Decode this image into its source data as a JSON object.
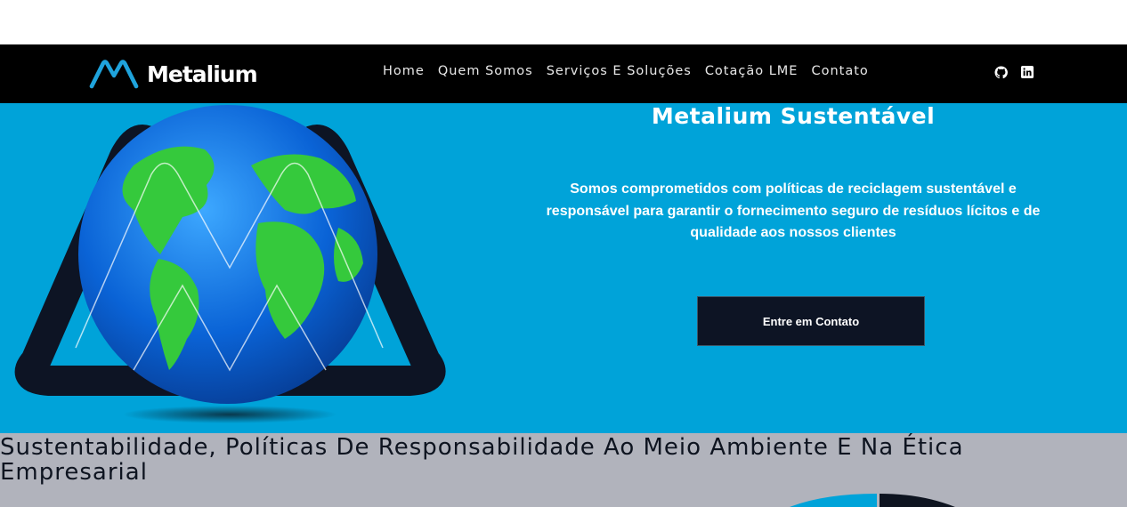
{
  "header": {
    "logo_text": "Metalium",
    "nav": [
      "Home",
      "Quem Somos",
      "Serviços E Soluções",
      "Cotação LME",
      "Contato"
    ],
    "social_icons": [
      "github-icon",
      "linkedin-icon"
    ]
  },
  "hero": {
    "title": "Metalium Sustentável",
    "text": "Somos comprometidos com políticas de reciclagem sustentável e responsável para garantir o fornecimento seguro de resíduos lícitos e de qualidade aos nossos clientes",
    "cta_label": "Entre em Contato"
  },
  "section2": {
    "title": "Sustentabilidade, Políticas De Responsabilidade Ao Meio Ambiente E Na Ética Empresarial"
  },
  "colors": {
    "navbar": "#000000",
    "hero_bg": "#00a3d9",
    "cta_bg": "#0d1424",
    "section2_bg": "#b1b3bc",
    "logo_accent": "#1fa3dc"
  }
}
